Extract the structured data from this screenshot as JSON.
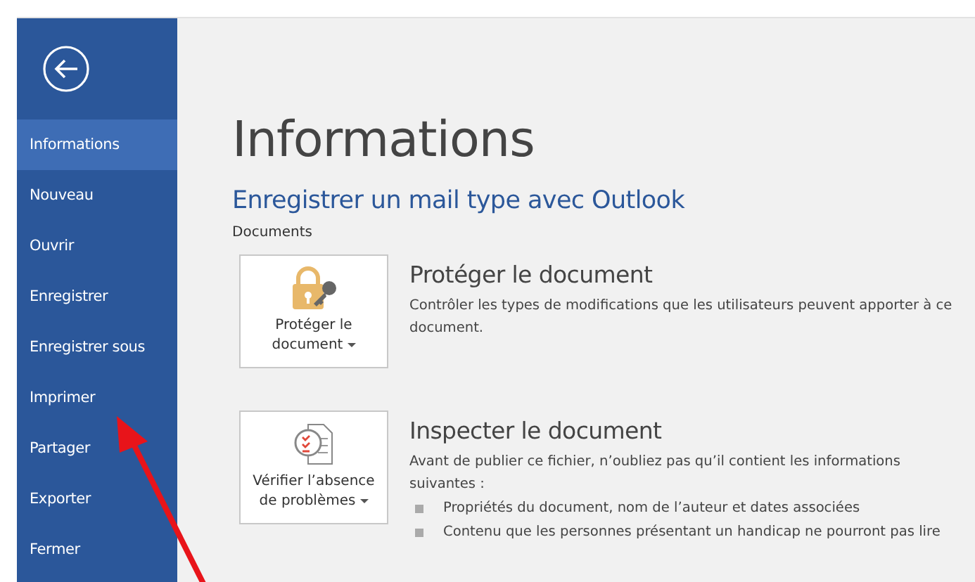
{
  "sidebar": {
    "items": [
      {
        "label": "Informations",
        "selected": true
      },
      {
        "label": "Nouveau",
        "selected": false
      },
      {
        "label": "Ouvrir",
        "selected": false
      },
      {
        "label": "Enregistrer",
        "selected": false
      },
      {
        "label": "Enregistrer sous",
        "selected": false
      },
      {
        "label": "Imprimer",
        "selected": false
      },
      {
        "label": "Partager",
        "selected": false
      },
      {
        "label": "Exporter",
        "selected": false
      },
      {
        "label": "Fermer",
        "selected": false
      }
    ]
  },
  "main": {
    "title": "Informations",
    "subtitle": "Enregistrer un mail type avec Outlook",
    "section_label": "Documents",
    "sections": [
      {
        "kind": "protect",
        "button": "Protéger le document",
        "title": "Protéger le document",
        "description": "Contrôler les types de modifications que les utilisateurs peuvent apporter à ce document."
      },
      {
        "kind": "inspect",
        "button": "Vérifier l’absence de problèmes",
        "title": "Inspecter le document",
        "description": "Avant de publier ce fichier, n’oubliez pas qu’il contient les informations suivantes :",
        "bullets": [
          "Propriétés du document, nom de l’auteur et dates associées",
          "Contenu que les personnes présentant un handicap ne pourront pas lire"
        ]
      }
    ]
  }
}
